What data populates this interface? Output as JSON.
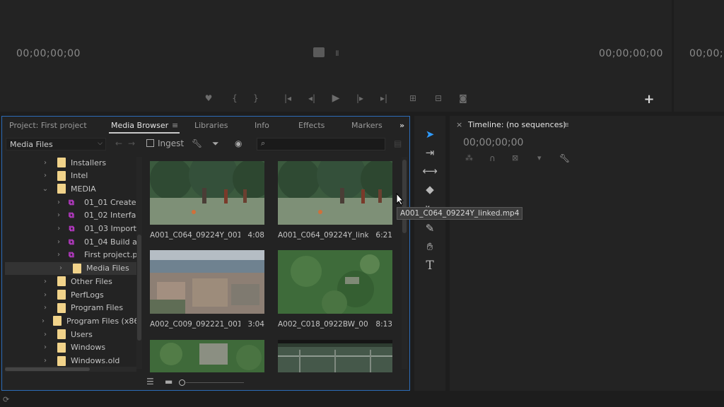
{
  "monitors": {
    "source_timecode_left": "00;00;00;00",
    "source_timecode_right": "00;00;00;00",
    "program_timecode": "00;00;00;00"
  },
  "project_panel": {
    "tabs": [
      {
        "label": "Project: First project",
        "active": false
      },
      {
        "label": "Media Browser",
        "active": true
      },
      {
        "label": "Libraries",
        "active": false
      },
      {
        "label": "Info",
        "active": false
      },
      {
        "label": "Effects",
        "active": false
      },
      {
        "label": "Markers",
        "active": false
      }
    ],
    "location_dropdown": "Media Files",
    "ingest_label": "Ingest",
    "search_placeholder": "",
    "tree": [
      {
        "label": "Installers",
        "type": "folder",
        "indent": 1,
        "expanded": false,
        "selected": false
      },
      {
        "label": "Intel",
        "type": "folder",
        "indent": 1,
        "expanded": false,
        "selected": false
      },
      {
        "label": "MEDIA",
        "type": "folder",
        "indent": 1,
        "expanded": true,
        "selected": false
      },
      {
        "label": "01_01 Create a",
        "type": "sequence",
        "indent": 2,
        "expanded": false,
        "selected": false
      },
      {
        "label": "01_02 Interfac",
        "type": "sequence",
        "indent": 2,
        "expanded": false,
        "selected": false
      },
      {
        "label": "01_03 Import",
        "type": "sequence",
        "indent": 2,
        "expanded": false,
        "selected": false
      },
      {
        "label": "01_04 Build a",
        "type": "sequence",
        "indent": 2,
        "expanded": false,
        "selected": false
      },
      {
        "label": "First project.p",
        "type": "sequence",
        "indent": 2,
        "expanded": false,
        "selected": false
      },
      {
        "label": "Media Files",
        "type": "folder",
        "indent": 2,
        "expanded": false,
        "selected": true
      },
      {
        "label": "Other Files",
        "type": "folder",
        "indent": 1,
        "expanded": false,
        "selected": false
      },
      {
        "label": "PerfLogs",
        "type": "folder",
        "indent": 1,
        "expanded": false,
        "selected": false
      },
      {
        "label": "Program Files",
        "type": "folder",
        "indent": 1,
        "expanded": false,
        "selected": false
      },
      {
        "label": "Program Files (x86",
        "type": "folder",
        "indent": 1,
        "expanded": false,
        "selected": false
      },
      {
        "label": "Users",
        "type": "folder",
        "indent": 1,
        "expanded": false,
        "selected": false
      },
      {
        "label": "Windows",
        "type": "folder",
        "indent": 1,
        "expanded": false,
        "selected": false
      },
      {
        "label": "Windows.old",
        "type": "folder",
        "indent": 1,
        "expanded": false,
        "selected": false
      }
    ],
    "clips": [
      {
        "name": "A001_C064_09224Y_001...",
        "duration": "4:08",
        "scene": "soccer"
      },
      {
        "name": "A001_C064_09224Y_link...",
        "duration": "6:21",
        "scene": "soccer"
      },
      {
        "name": "A002_C009_092221_001...",
        "duration": "3:04",
        "scene": "aerial-town"
      },
      {
        "name": "A002_C018_0922BW_00...",
        "duration": "8:13",
        "scene": "forest"
      },
      {
        "name": "",
        "duration": "",
        "scene": "forest-ruins"
      },
      {
        "name": "",
        "duration": "",
        "scene": "fence"
      }
    ]
  },
  "tooltip": {
    "text": "A001_C064_09224Y_linked.mp4"
  },
  "timeline": {
    "title": "Timeline: (no sequences)",
    "timecode": "00;00;00;00"
  },
  "colors": {
    "panel_focus_border": "#2d6cb8",
    "folder": "#f1d38a",
    "sequence_icon": "#c73cd6",
    "selection_tool": "#2f9bff"
  }
}
